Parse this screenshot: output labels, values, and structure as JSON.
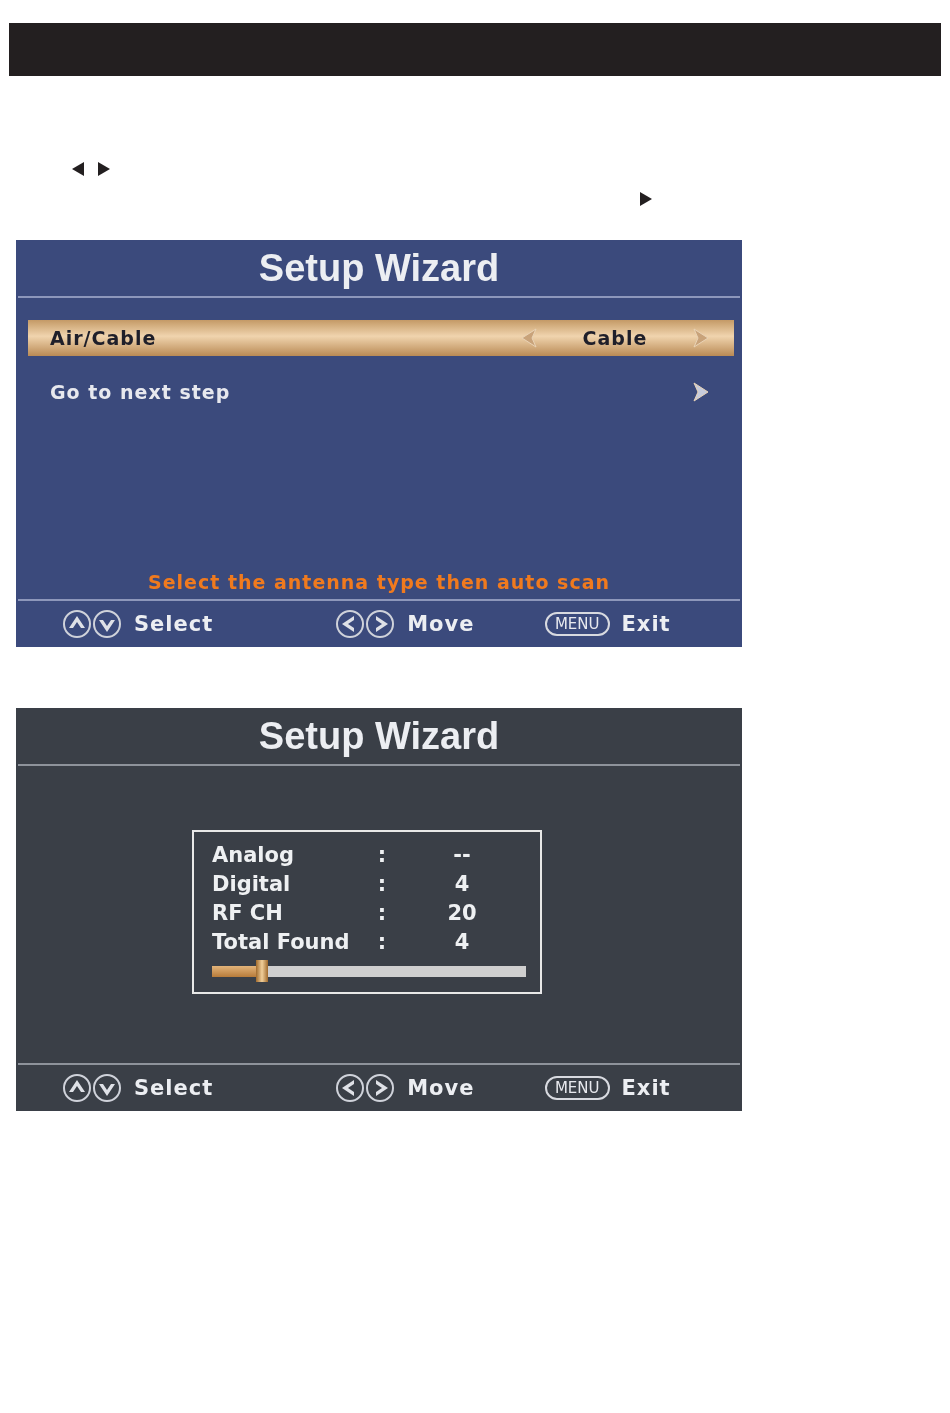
{
  "screens": [
    {
      "title": "Setup Wizard",
      "kind": "menu",
      "items": [
        {
          "kind": "option",
          "label": "Air/Cable",
          "value": "Cable",
          "selected": true
        },
        {
          "kind": "link",
          "label": "Go to next step",
          "selected": false
        }
      ],
      "hint": "Select the antenna type then auto scan",
      "footer": [
        {
          "kind": "updown",
          "label": "Select"
        },
        {
          "kind": "leftright",
          "label": "Move"
        },
        {
          "kind": "key",
          "key": "MENU",
          "label": "Exit"
        }
      ]
    },
    {
      "title": "Setup Wizard",
      "kind": "scan",
      "scan": {
        "rows": [
          {
            "label": "Analog",
            "colon": ":",
            "value": "--"
          },
          {
            "label": "Digital",
            "colon": ":",
            "value": "4"
          },
          {
            "label": "RF CH",
            "colon": ":",
            "value": "20"
          },
          {
            "label": "Total Found",
            "colon": ":",
            "value": "4"
          }
        ],
        "level": 0.16
      },
      "footer": [
        {
          "kind": "updown",
          "label": "Select"
        },
        {
          "kind": "leftright",
          "label": "Move"
        },
        {
          "kind": "key",
          "key": "MENU",
          "label": "Exit"
        }
      ]
    }
  ]
}
